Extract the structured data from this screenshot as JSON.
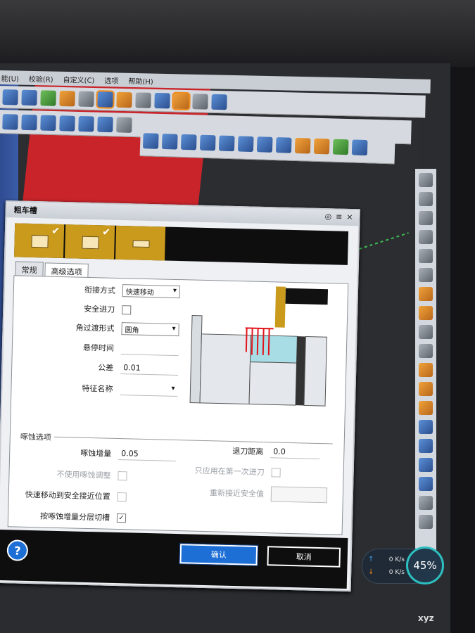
{
  "menu": [
    "能(U)",
    "校验(R)",
    "自定义(C)",
    "选项",
    "帮助(H)"
  ],
  "dialog": {
    "title": "粗车槽",
    "controls": [
      "◎",
      "≡",
      "×"
    ],
    "tabs": [
      "常规",
      "高级选项"
    ],
    "active_tab": 1,
    "fields": {
      "connect_label": "衔接方式",
      "connect_value": "快速移动",
      "safe_feed_label": "安全进刀",
      "corner_label": "角过渡形式",
      "corner_value": "圆角",
      "dwell_label": "悬停时间",
      "tolerance_label": "公差",
      "tolerance_value": "0.01",
      "feature_label": "特征名称"
    },
    "peck": {
      "section_title": "啄蚀选项",
      "increment_label": "啄蚀增量",
      "increment_value": "0.05",
      "retract_label": "退刀距离",
      "retract_value": "0.0",
      "no_adjust_label": "不使用啄蚀调整",
      "first_feed_only_label": "只应用在第一次进刀",
      "rapid_safe_label": "快速移动到安全接近位置",
      "reapproach_label": "重新接近安全值",
      "layer_label": "按啄蚀增量分层切槽",
      "layer_checked": "✓"
    },
    "ok_label": "确认",
    "cancel_label": "取消",
    "help_label": "?"
  },
  "speed": {
    "up": "0 K/s",
    "down": "0 K/s",
    "percent": "45%",
    "up_arrow": "↑",
    "down_arrow": "↓"
  },
  "axis_label": "xyz",
  "colors": {
    "accent_blue": "#1d6fd6",
    "step_gold": "#c99a1c",
    "viewport_red": "#c8242a"
  }
}
